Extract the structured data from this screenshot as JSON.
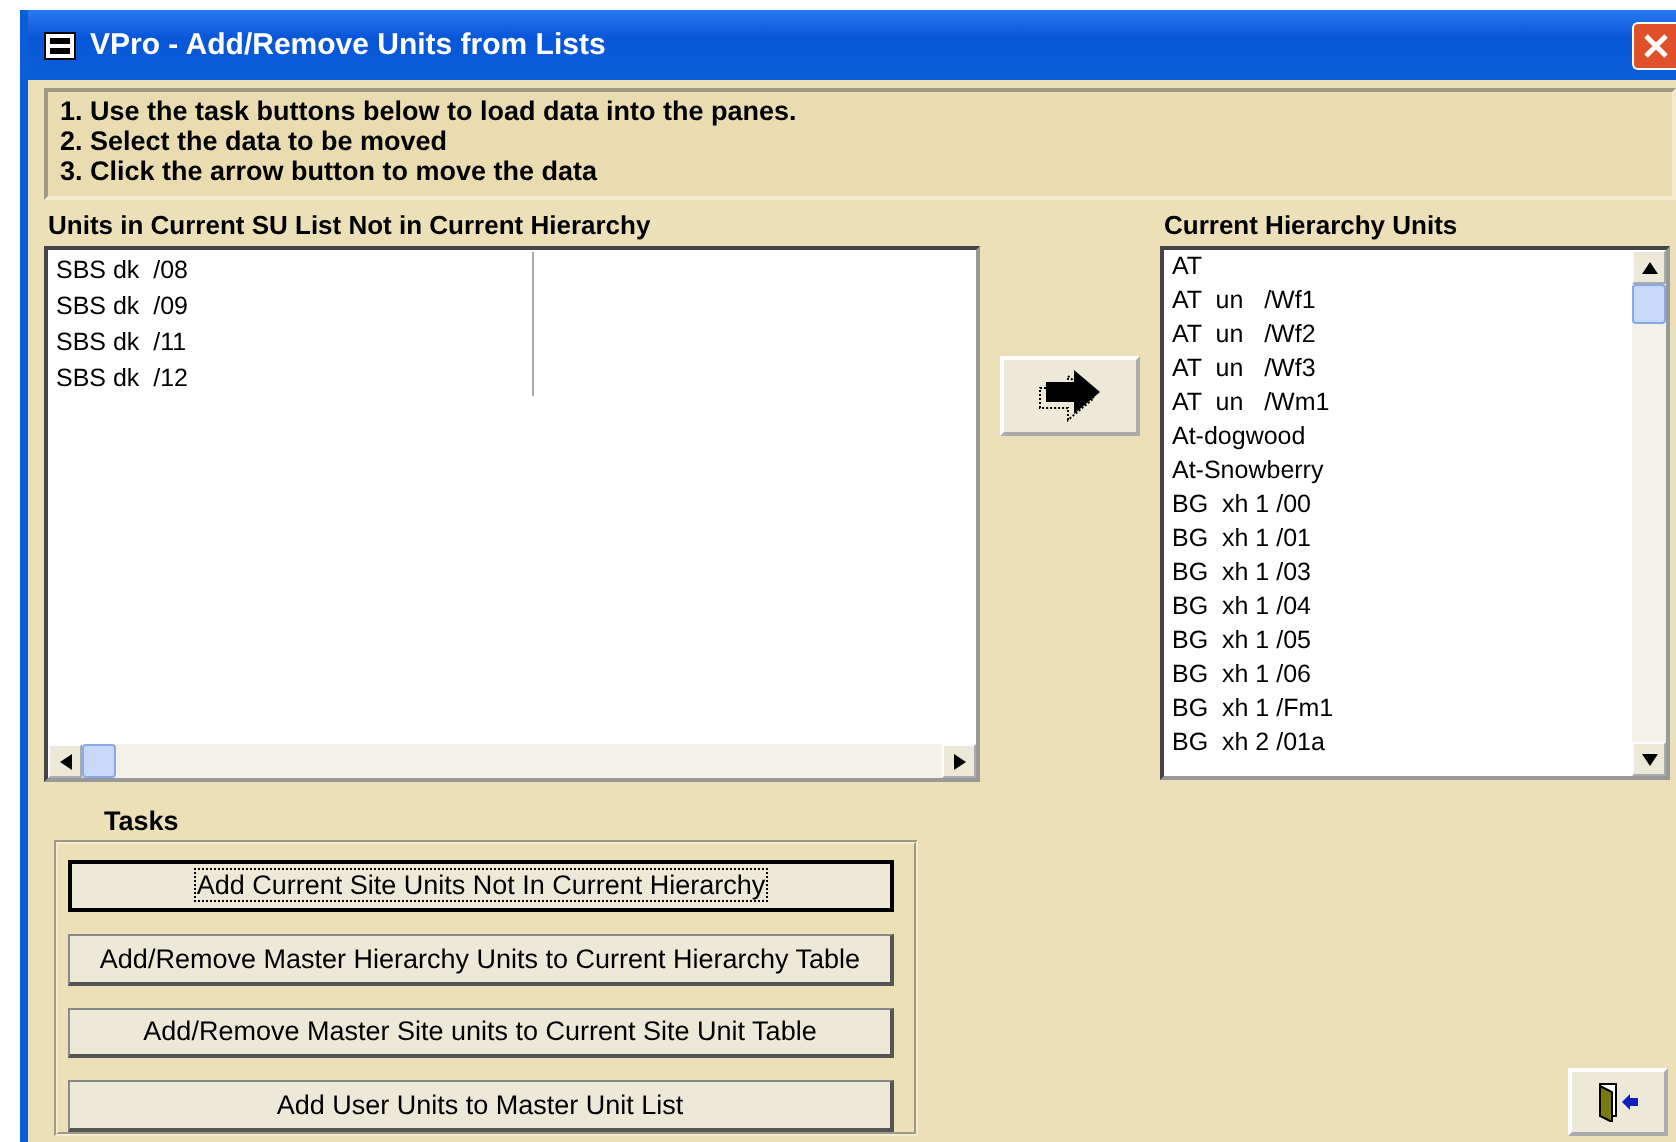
{
  "window": {
    "title": "VPro - Add/Remove Units from Lists"
  },
  "instructions": [
    "1.  Use the task buttons below to load data into the panes.",
    "2.  Select the data to be moved",
    "3.  Click the arrow button to move the data"
  ],
  "left_list": {
    "label": "Units in Current SU List Not in Current Hierarchy",
    "items": [
      "SBS dk  /08",
      "SBS dk  /09",
      "SBS dk  /11",
      "SBS dk  /12"
    ]
  },
  "right_list": {
    "label": "Current Hierarchy Units",
    "items": [
      "AT",
      "AT  un   /Wf1",
      "AT  un   /Wf2",
      "AT  un   /Wf3",
      "AT  un   /Wm1",
      "At-dogwood",
      "At-Snowberry",
      "BG  xh 1 /00",
      "BG  xh 1 /01",
      "BG  xh 1 /03",
      "BG  xh 1 /04",
      "BG  xh 1 /05",
      "BG  xh 1 /06",
      "BG  xh 1 /Fm1",
      "BG  xh 2 /01a"
    ]
  },
  "tasks": {
    "label": "Tasks",
    "buttons": [
      {
        "label": "Add Current Site Units Not In Current Hierarchy",
        "focused": true
      },
      {
        "label": "Add/Remove Master Hierarchy Units to Current Hierarchy Table",
        "focused": false
      },
      {
        "label": "Add/Remove Master Site units to Current Site Unit Table",
        "focused": false
      },
      {
        "label": "Add User Units to Master Unit List",
        "focused": false
      }
    ]
  }
}
